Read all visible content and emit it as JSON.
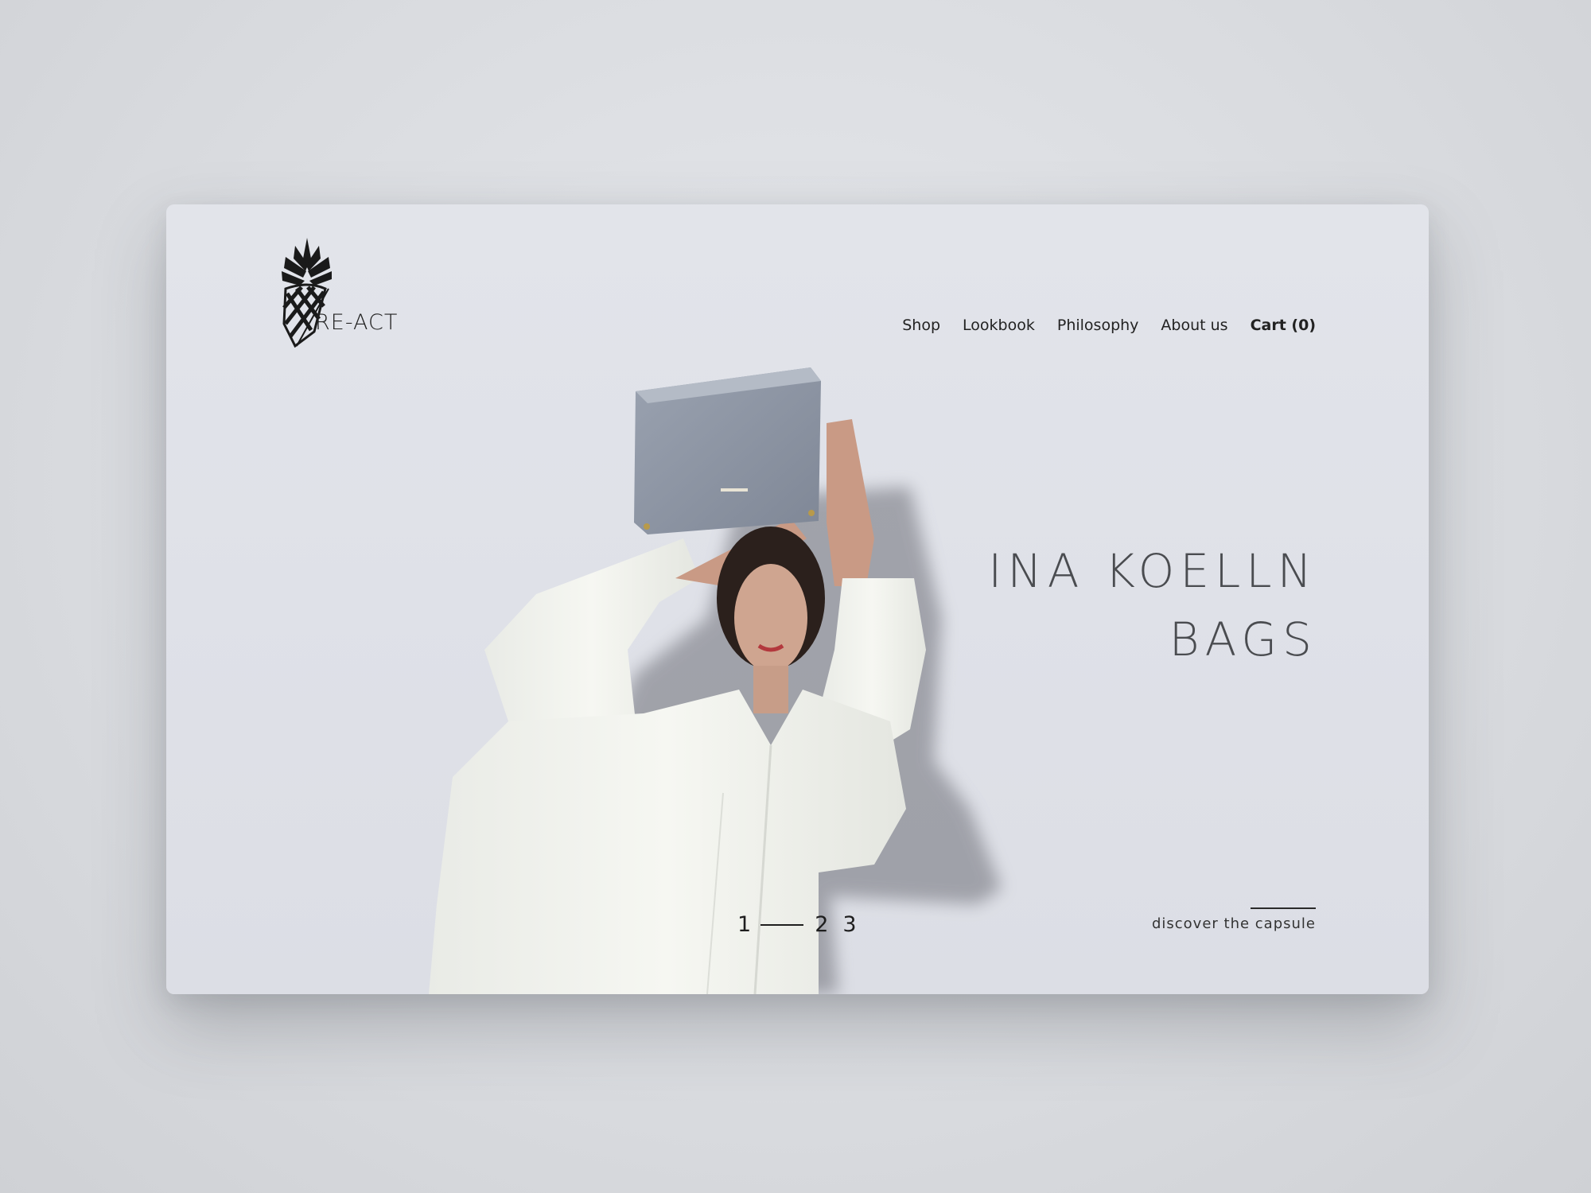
{
  "brand": {
    "name": "RE-ACT"
  },
  "nav": {
    "shop": "Shop",
    "lookbook": "Lookbook",
    "philosophy": "Philosophy",
    "about": "About us",
    "cart": "Cart (0)"
  },
  "hero": {
    "headline_line1": "INA KOELLN",
    "headline_line2": "BAGS"
  },
  "pager": {
    "page1": "1",
    "page2": "2",
    "page3": "3",
    "active": 1
  },
  "cta": {
    "label": "discover the capsule"
  },
  "colors": {
    "background": "#dfe1e7",
    "headline": "#4a4c50",
    "text": "#222222"
  }
}
